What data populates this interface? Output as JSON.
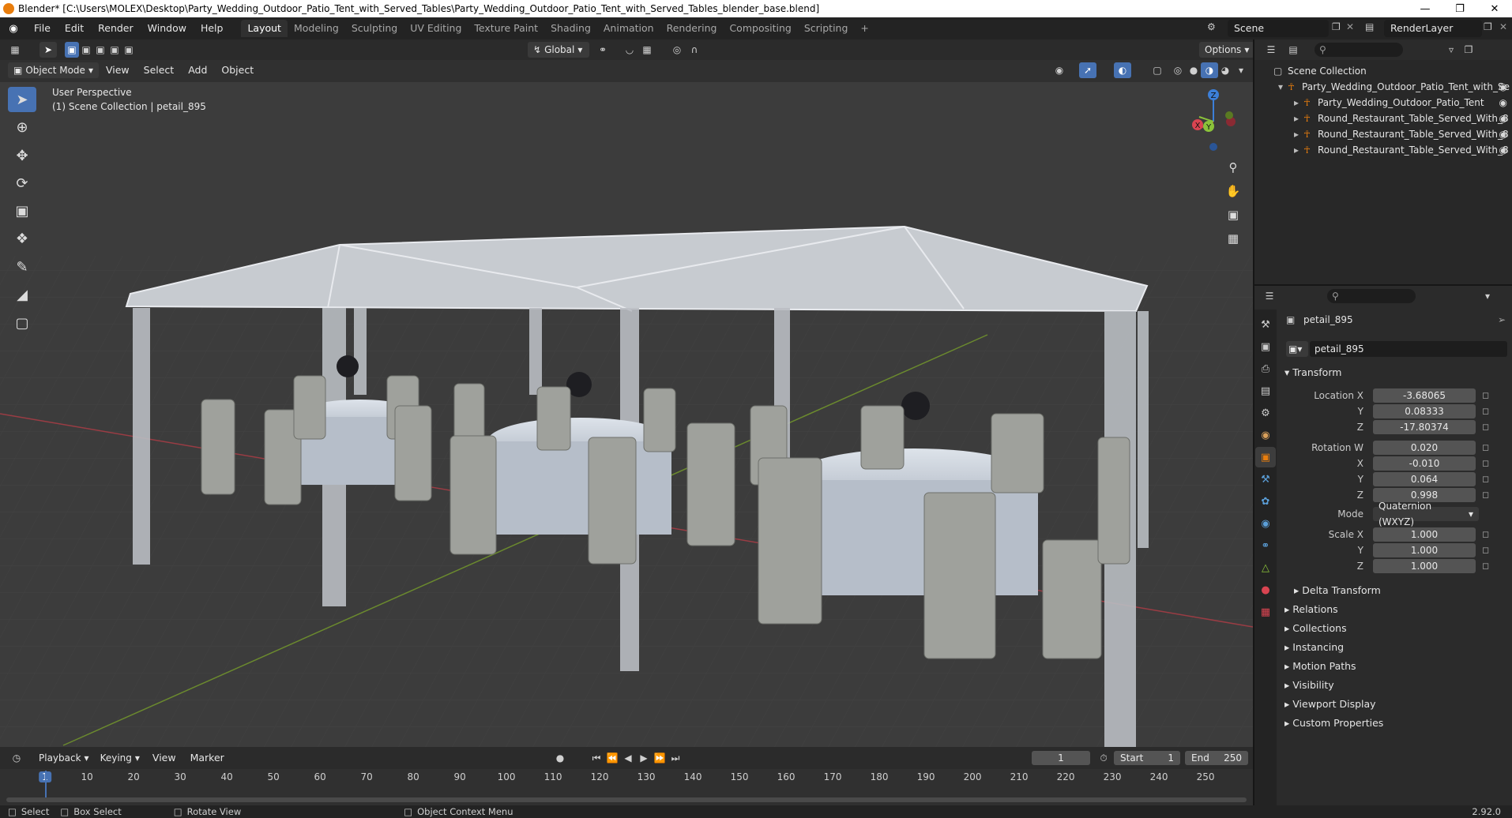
{
  "window": {
    "title": "Blender* [C:\\Users\\MOLEX\\Desktop\\Party_Wedding_Outdoor_Patio_Tent_with_Served_Tables\\Party_Wedding_Outdoor_Patio_Tent_with_Served_Tables_blender_base.blend]"
  },
  "menubar": {
    "items": [
      "File",
      "Edit",
      "Render",
      "Window",
      "Help"
    ]
  },
  "workspaces": {
    "tabs": [
      "Layout",
      "Modeling",
      "Sculpting",
      "UV Editing",
      "Texture Paint",
      "Shading",
      "Animation",
      "Rendering",
      "Compositing",
      "Scripting"
    ],
    "active": "Layout",
    "add": "+"
  },
  "scene": {
    "name": "Scene",
    "render_layer": "RenderLayer"
  },
  "viewport_header": {
    "mode": "Object Mode",
    "menus": [
      "View",
      "Select",
      "Add",
      "Object"
    ],
    "transform": "Global",
    "options": "Options"
  },
  "viewport": {
    "perspective": "User Perspective",
    "collection": "(1) Scene Collection | petail_895",
    "axes": {
      "x": "X",
      "y": "Y",
      "z": "Z"
    }
  },
  "outliner": {
    "root": "Scene Collection",
    "items": [
      {
        "label": "Party_Wedding_Outdoor_Patio_Tent_with_Se",
        "level": 1
      },
      {
        "label": "Party_Wedding_Outdoor_Patio_Tent",
        "level": 2
      },
      {
        "label": "Round_Restaurant_Table_Served_With_8",
        "level": 2
      },
      {
        "label": "Round_Restaurant_Table_Served_With_8",
        "level": 2
      },
      {
        "label": "Round_Restaurant_Table_Served_With_8",
        "level": 2
      }
    ]
  },
  "properties": {
    "object_name": "petail_895",
    "datablock": "petail_895",
    "transform_label": "Transform",
    "location": {
      "label": "Location X",
      "x": "-3.68065",
      "y": "0.08333",
      "z": "-17.80374"
    },
    "rotation": {
      "label": "Rotation W",
      "w": "0.020",
      "x": "-0.010",
      "y": "0.064",
      "z": "0.998"
    },
    "mode": {
      "label": "Mode",
      "value": "Quaternion (WXYZ)"
    },
    "scale": {
      "label": "Scale X",
      "x": "1.000",
      "y": "1.000",
      "z": "1.000"
    },
    "axis_labels": {
      "y": "Y",
      "z": "Z",
      "x": "X"
    },
    "sections": [
      "Delta Transform",
      "Relations",
      "Collections",
      "Instancing",
      "Motion Paths",
      "Visibility",
      "Viewport Display",
      "Custom Properties"
    ]
  },
  "timeline": {
    "menus": [
      "Playback",
      "Keying",
      "View",
      "Marker"
    ],
    "current_frame": "1",
    "start_label": "Start",
    "start": "1",
    "end_label": "End",
    "end": "250",
    "ticks": [
      "1",
      "10",
      "20",
      "30",
      "40",
      "50",
      "60",
      "70",
      "80",
      "90",
      "100",
      "110",
      "120",
      "130",
      "140",
      "150",
      "160",
      "170",
      "180",
      "190",
      "200",
      "210",
      "220",
      "230",
      "240",
      "250"
    ]
  },
  "statusbar": {
    "select": "Select",
    "box_select": "Box Select",
    "rotate_view": "Rotate View",
    "context_menu": "Object Context Menu",
    "version": "2.92.0"
  },
  "colors": {
    "accent": "#4772b3",
    "object_orange": "#e87d0d",
    "x_axis": "#d94451",
    "y_axis": "#8bc33a",
    "z_axis": "#3c7fd8"
  }
}
